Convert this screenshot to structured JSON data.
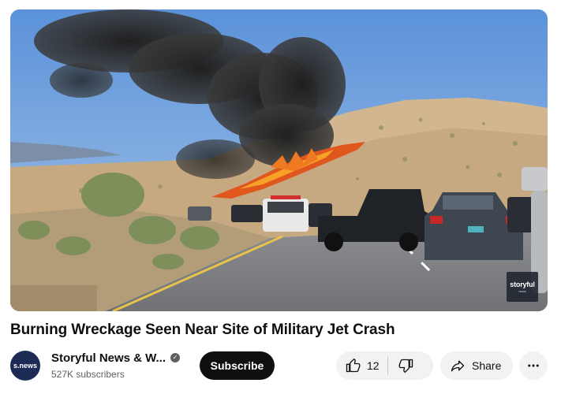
{
  "video": {
    "title": "Burning Wreckage Seen Near Site of Military Jet Crash",
    "watermark": "storyful",
    "watermark_sub": "news"
  },
  "channel": {
    "avatar_text": "s.news",
    "name": "Storyful News & W...",
    "subscribers": "527K subscribers",
    "verified_icon": "verified-check-icon"
  },
  "actions": {
    "subscribe_label": "Subscribe",
    "like_count": "12",
    "share_label": "Share",
    "icons": [
      "thumbs-up-icon",
      "thumbs-down-icon",
      "share-arrow-icon",
      "more-vert-icon"
    ]
  },
  "colors": {
    "subscribe_bg": "#0f0f0f",
    "pill_bg": "#f2f2f2",
    "secondary_text": "#606060",
    "avatar_bg": "#1c2a55"
  }
}
